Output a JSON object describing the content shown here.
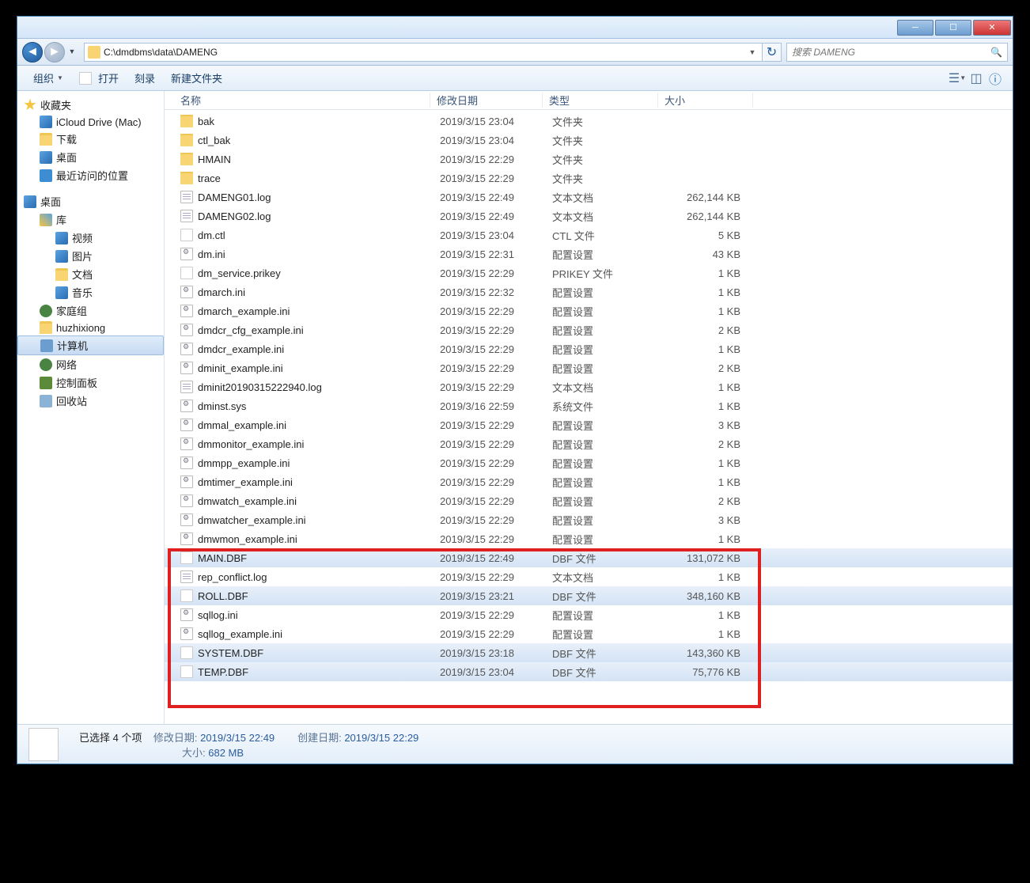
{
  "address": "C:\\dmdbms\\data\\DAMENG",
  "search_placeholder": "搜索 DAMENG",
  "toolbar": {
    "organize": "组织",
    "open": "打开",
    "burn": "刻录",
    "new_folder": "新建文件夹"
  },
  "sidebar": {
    "favorites": "收藏夹",
    "icloud": "iCloud Drive (Mac)",
    "downloads": "下载",
    "desktop": "桌面",
    "recent": "最近访问的位置",
    "desktop2": "桌面",
    "libraries": "库",
    "videos": "视频",
    "pictures": "图片",
    "documents": "文档",
    "music": "音乐",
    "homegroup": "家庭组",
    "user": "huzhixiong",
    "computer": "计算机",
    "network": "网络",
    "cpanel": "控制面板",
    "recycle": "回收站"
  },
  "columns": {
    "name": "名称",
    "date": "修改日期",
    "type": "类型",
    "size": "大小"
  },
  "files": [
    {
      "name": "bak",
      "date": "2019/3/15 23:04",
      "type": "文件夹",
      "size": "",
      "icon": "fold",
      "sel": false
    },
    {
      "name": "ctl_bak",
      "date": "2019/3/15 23:04",
      "type": "文件夹",
      "size": "",
      "icon": "fold",
      "sel": false
    },
    {
      "name": "HMAIN",
      "date": "2019/3/15 22:29",
      "type": "文件夹",
      "size": "",
      "icon": "fold",
      "sel": false
    },
    {
      "name": "trace",
      "date": "2019/3/15 22:29",
      "type": "文件夹",
      "size": "",
      "icon": "fold",
      "sel": false
    },
    {
      "name": "DAMENG01.log",
      "date": "2019/3/15 22:49",
      "type": "文本文档",
      "size": "262,144 KB",
      "icon": "doc",
      "sel": false
    },
    {
      "name": "DAMENG02.log",
      "date": "2019/3/15 22:49",
      "type": "文本文档",
      "size": "262,144 KB",
      "icon": "doc",
      "sel": false
    },
    {
      "name": "dm.ctl",
      "date": "2019/3/15 23:04",
      "type": "CTL 文件",
      "size": "5 KB",
      "icon": "file",
      "sel": false
    },
    {
      "name": "dm.ini",
      "date": "2019/3/15 22:31",
      "type": "配置设置",
      "size": "43 KB",
      "icon": "ini",
      "sel": false
    },
    {
      "name": "dm_service.prikey",
      "date": "2019/3/15 22:29",
      "type": "PRIKEY 文件",
      "size": "1 KB",
      "icon": "file",
      "sel": false
    },
    {
      "name": "dmarch.ini",
      "date": "2019/3/15 22:32",
      "type": "配置设置",
      "size": "1 KB",
      "icon": "ini",
      "sel": false
    },
    {
      "name": "dmarch_example.ini",
      "date": "2019/3/15 22:29",
      "type": "配置设置",
      "size": "1 KB",
      "icon": "ini",
      "sel": false
    },
    {
      "name": "dmdcr_cfg_example.ini",
      "date": "2019/3/15 22:29",
      "type": "配置设置",
      "size": "2 KB",
      "icon": "ini",
      "sel": false
    },
    {
      "name": "dmdcr_example.ini",
      "date": "2019/3/15 22:29",
      "type": "配置设置",
      "size": "1 KB",
      "icon": "ini",
      "sel": false
    },
    {
      "name": "dminit_example.ini",
      "date": "2019/3/15 22:29",
      "type": "配置设置",
      "size": "2 KB",
      "icon": "ini",
      "sel": false
    },
    {
      "name": "dminit20190315222940.log",
      "date": "2019/3/15 22:29",
      "type": "文本文档",
      "size": "1 KB",
      "icon": "doc",
      "sel": false
    },
    {
      "name": "dminst.sys",
      "date": "2019/3/16 22:59",
      "type": "系统文件",
      "size": "1 KB",
      "icon": "ini",
      "sel": false
    },
    {
      "name": "dmmal_example.ini",
      "date": "2019/3/15 22:29",
      "type": "配置设置",
      "size": "3 KB",
      "icon": "ini",
      "sel": false
    },
    {
      "name": "dmmonitor_example.ini",
      "date": "2019/3/15 22:29",
      "type": "配置设置",
      "size": "2 KB",
      "icon": "ini",
      "sel": false
    },
    {
      "name": "dmmpp_example.ini",
      "date": "2019/3/15 22:29",
      "type": "配置设置",
      "size": "1 KB",
      "icon": "ini",
      "sel": false
    },
    {
      "name": "dmtimer_example.ini",
      "date": "2019/3/15 22:29",
      "type": "配置设置",
      "size": "1 KB",
      "icon": "ini",
      "sel": false
    },
    {
      "name": "dmwatch_example.ini",
      "date": "2019/3/15 22:29",
      "type": "配置设置",
      "size": "2 KB",
      "icon": "ini",
      "sel": false
    },
    {
      "name": "dmwatcher_example.ini",
      "date": "2019/3/15 22:29",
      "type": "配置设置",
      "size": "3 KB",
      "icon": "ini",
      "sel": false
    },
    {
      "name": "dmwmon_example.ini",
      "date": "2019/3/15 22:29",
      "type": "配置设置",
      "size": "1 KB",
      "icon": "ini",
      "sel": false
    },
    {
      "name": "MAIN.DBF",
      "date": "2019/3/15 22:49",
      "type": "DBF 文件",
      "size": "131,072 KB",
      "icon": "file",
      "sel": true
    },
    {
      "name": "rep_conflict.log",
      "date": "2019/3/15 22:29",
      "type": "文本文档",
      "size": "1 KB",
      "icon": "doc",
      "sel": false
    },
    {
      "name": "ROLL.DBF",
      "date": "2019/3/15 23:21",
      "type": "DBF 文件",
      "size": "348,160 KB",
      "icon": "file",
      "sel": true
    },
    {
      "name": "sqllog.ini",
      "date": "2019/3/15 22:29",
      "type": "配置设置",
      "size": "1 KB",
      "icon": "ini",
      "sel": false
    },
    {
      "name": "sqllog_example.ini",
      "date": "2019/3/15 22:29",
      "type": "配置设置",
      "size": "1 KB",
      "icon": "ini",
      "sel": false
    },
    {
      "name": "SYSTEM.DBF",
      "date": "2019/3/15 23:18",
      "type": "DBF 文件",
      "size": "143,360 KB",
      "icon": "file",
      "sel": true
    },
    {
      "name": "TEMP.DBF",
      "date": "2019/3/15 23:04",
      "type": "DBF 文件",
      "size": "75,776 KB",
      "icon": "file",
      "sel": true
    }
  ],
  "status": {
    "selected": "已选择 4 个项",
    "mod_label": "修改日期:",
    "mod_value": "2019/3/15 22:49",
    "size_label": "大小:",
    "size_value": "682 MB",
    "created_label": "创建日期:",
    "created_value": "2019/3/15 22:29"
  }
}
